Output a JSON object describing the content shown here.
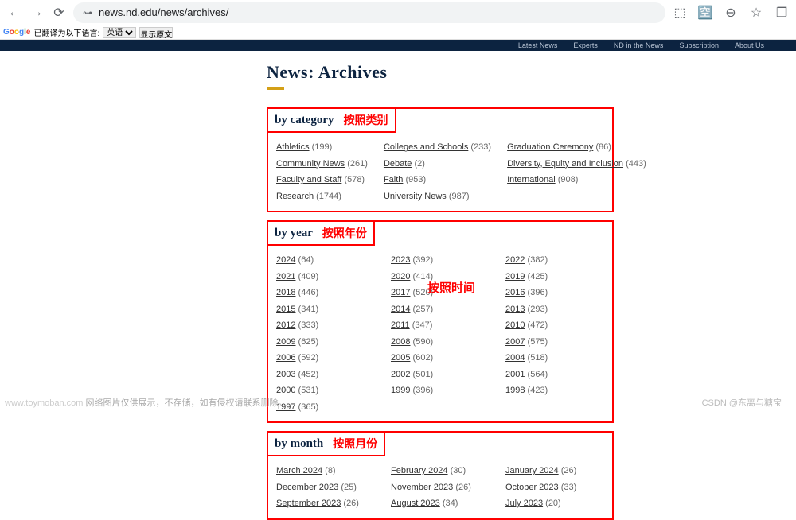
{
  "browser": {
    "url": "news.nd.edu/news/archives/",
    "gbar_text": "已翻译为以下语言:",
    "gbar_lang": "英语",
    "gbar_btn": "显示原文"
  },
  "topnav": [
    "Latest News",
    "Experts",
    "ND in the News",
    "Subscription",
    "About Us"
  ],
  "page_title": "News: Archives",
  "category": {
    "title": "by category",
    "anno": "按照类别",
    "col1": [
      {
        "label": "Athletics",
        "count": "(199)"
      },
      {
        "label": "Community News",
        "count": "(261)"
      },
      {
        "label": "Faculty and Staff",
        "count": "(578)"
      },
      {
        "label": "Research",
        "count": "(1744)"
      }
    ],
    "col2": [
      {
        "label": "Colleges and Schools",
        "count": "(233)"
      },
      {
        "label": "Debate",
        "count": "(2)"
      },
      {
        "label": "Faith",
        "count": "(953)"
      },
      {
        "label": "University News",
        "count": "(987)"
      }
    ],
    "col3": [
      {
        "label": "Graduation Ceremony",
        "count": "(86)"
      },
      {
        "label": "Diversity, Equity and Inclusion",
        "count": "(443)"
      },
      {
        "label": "International",
        "count": "(908)"
      }
    ]
  },
  "year": {
    "title": "by year",
    "anno": "按照年份",
    "float_anno": "按照时间",
    "col1": [
      {
        "label": "2024",
        "count": "(64)"
      },
      {
        "label": "2021",
        "count": "(409)"
      },
      {
        "label": "2018",
        "count": "(446)"
      },
      {
        "label": "2015",
        "count": "(341)"
      },
      {
        "label": "2012",
        "count": "(333)"
      },
      {
        "label": "2009",
        "count": "(625)"
      },
      {
        "label": "2006",
        "count": "(592)"
      },
      {
        "label": "2003",
        "count": "(452)"
      },
      {
        "label": "2000",
        "count": "(531)"
      },
      {
        "label": "1997",
        "count": "(365)"
      }
    ],
    "col2": [
      {
        "label": "2023",
        "count": "(392)"
      },
      {
        "label": "2020",
        "count": "(414)"
      },
      {
        "label": "2017",
        "count": "(520)"
      },
      {
        "label": "2014",
        "count": "(257)"
      },
      {
        "label": "2011",
        "count": "(347)"
      },
      {
        "label": "2008",
        "count": "(590)"
      },
      {
        "label": "2005",
        "count": "(602)"
      },
      {
        "label": "2002",
        "count": "(501)"
      },
      {
        "label": "1999",
        "count": "(396)"
      }
    ],
    "col3": [
      {
        "label": "2022",
        "count": "(382)"
      },
      {
        "label": "2019",
        "count": "(425)"
      },
      {
        "label": "2016",
        "count": "(396)"
      },
      {
        "label": "2013",
        "count": "(293)"
      },
      {
        "label": "2010",
        "count": "(472)"
      },
      {
        "label": "2007",
        "count": "(575)"
      },
      {
        "label": "2004",
        "count": "(518)"
      },
      {
        "label": "2001",
        "count": "(564)"
      },
      {
        "label": "1998",
        "count": "(423)"
      }
    ]
  },
  "month": {
    "title": "by month",
    "anno": "按照月份",
    "col1": [
      {
        "label": "March 2024",
        "count": "(8)"
      },
      {
        "label": "December 2023",
        "count": "(25)"
      },
      {
        "label": "September 2023",
        "count": "(26)"
      }
    ],
    "col2": [
      {
        "label": "February 2024",
        "count": "(30)"
      },
      {
        "label": "November 2023",
        "count": "(26)"
      },
      {
        "label": "August 2023",
        "count": "(34)"
      }
    ],
    "col3": [
      {
        "label": "January 2024",
        "count": "(26)"
      },
      {
        "label": "October 2023",
        "count": "(33)"
      },
      {
        "label": "July 2023",
        "count": "(20)"
      }
    ]
  },
  "footer": {
    "left_prefix": "www.toymoban.com",
    "left_rest": "  网络图片仅供展示，不存储，如有侵权请联系删除。",
    "right": "CSDN @东离与糖宝"
  }
}
